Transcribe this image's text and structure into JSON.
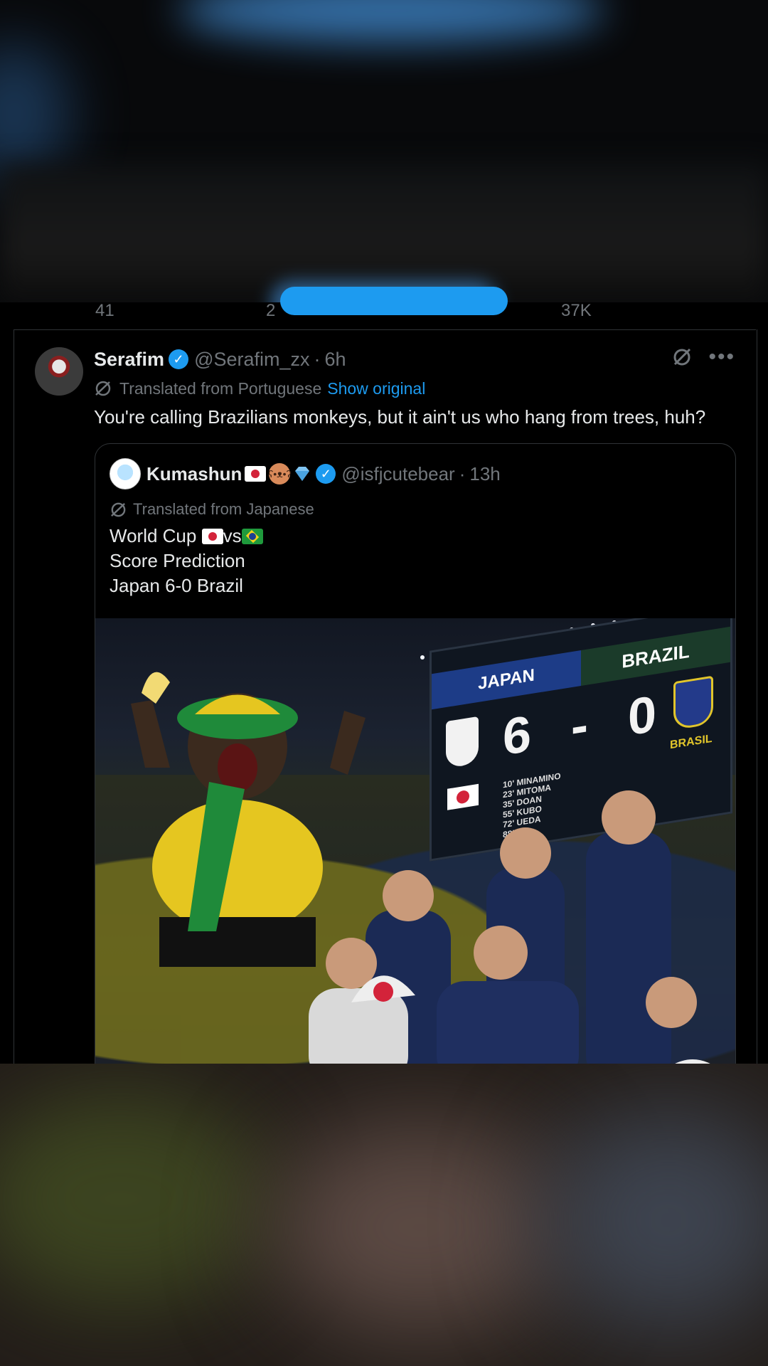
{
  "action_strip": {
    "replies": "41",
    "reposts": "2",
    "views": "37K"
  },
  "tweet": {
    "author_name": "Serafim",
    "handle": "@Serafim_zx",
    "dot": "·",
    "time": "6h",
    "translated_label": "Translated from Portuguese",
    "show_original": "Show original",
    "text": "You're calling Brazilians monkeys, but it ain't us who hang from trees, huh?"
  },
  "quote": {
    "author_name": "Kumashun",
    "handle": "@isfjcutebear",
    "dot": "·",
    "time": "13h",
    "translated_label": "Translated from Japanese",
    "line1_prefix": "World Cup ",
    "line1_vs": "vs",
    "line2": "Score Prediction",
    "line3": "Japan 6-0 Brazil"
  },
  "media": {
    "board_japan": "JAPAN",
    "board_brazil": "BRAZIL",
    "board_score": "6 - 0",
    "board_brasil": "BRASIL",
    "scorers": [
      "10' MINAMINO",
      "23' MITOMA",
      "35' DOAN",
      "55' KUBO",
      "72' UEDA",
      "88' ITO"
    ]
  },
  "colors": {
    "accent": "#1d9bf0",
    "muted": "#71767b",
    "text": "#e7e9ea",
    "border": "#2f3336"
  },
  "icons": [
    "verified-badge-icon",
    "grok-icon",
    "more-icon",
    "translate-icon",
    "japan-flag-icon",
    "brazil-flag-icon",
    "bear-icon",
    "gem-icon"
  ]
}
